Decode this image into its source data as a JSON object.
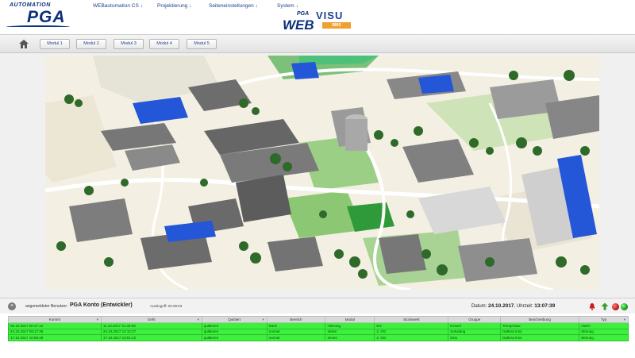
{
  "header": {
    "logo_top": "AUTOMATION",
    "logo_main": "PGA",
    "menu": [
      {
        "label": "WEBautomation CS ↓"
      },
      {
        "label": "Projektierung ↓"
      },
      {
        "label": "Seiteneinstellungen ↓"
      },
      {
        "label": "System ↓"
      }
    ],
    "webvisu": {
      "pga": "PGA",
      "web": "WEB",
      "visu": "VISU",
      "bms": "BMS"
    }
  },
  "nav": {
    "home_icon": "home-icon",
    "modules": [
      "Modul 1",
      "Modul 2",
      "Modul 3",
      "Modul 4",
      "Modul 5"
    ]
  },
  "colors": {
    "brand_blue": "#0b2f7a",
    "alarm_green": "#3ef03e",
    "roof_blue": "#2456d8",
    "led_red": "#c41a1a",
    "led_green": "#1a9a1a"
  },
  "status": {
    "user_label": "angemeldeter Benutzer:",
    "user_name": "PGA Konto (Entwickler)",
    "logout": "Autologoff: 00:09:53",
    "date_label": "Datum:",
    "date": "24.10.2017",
    "time_label": "Uhrzeit:",
    "time": "13:07:39",
    "icons": [
      "bell-icon",
      "arrow-up-icon",
      "led-red",
      "led-green"
    ]
  },
  "alarms": {
    "headers": [
      "Kommt",
      "Geht",
      "Quittiert",
      "Bereich",
      "Modul",
      "Stockwerk",
      "Gruppe",
      "Beschreibung",
      "Typ"
    ],
    "rows": [
      [
        "05.10.2017 00:47:12",
        "11.10.2017 21:33:09",
        "quittieren",
        "Sank",
        "Heizung",
        "EG",
        "Kessel",
        "Temperatur",
        "Alarm"
      ],
      [
        "24.10.2017 09:17:36",
        "24.10.2017 12:12:27",
        "quittieren",
        "normal",
        "Iimlen",
        "2. OG",
        "Sohalung",
        "Daltera Inns",
        "Störung"
      ],
      [
        "17.10.2017 10:55:49",
        "17.10.2017 10:51:42",
        "quittieren",
        "normal",
        "Inmen",
        "2. OG",
        "Dins",
        "Daltera Inns",
        "Störung"
      ]
    ]
  }
}
